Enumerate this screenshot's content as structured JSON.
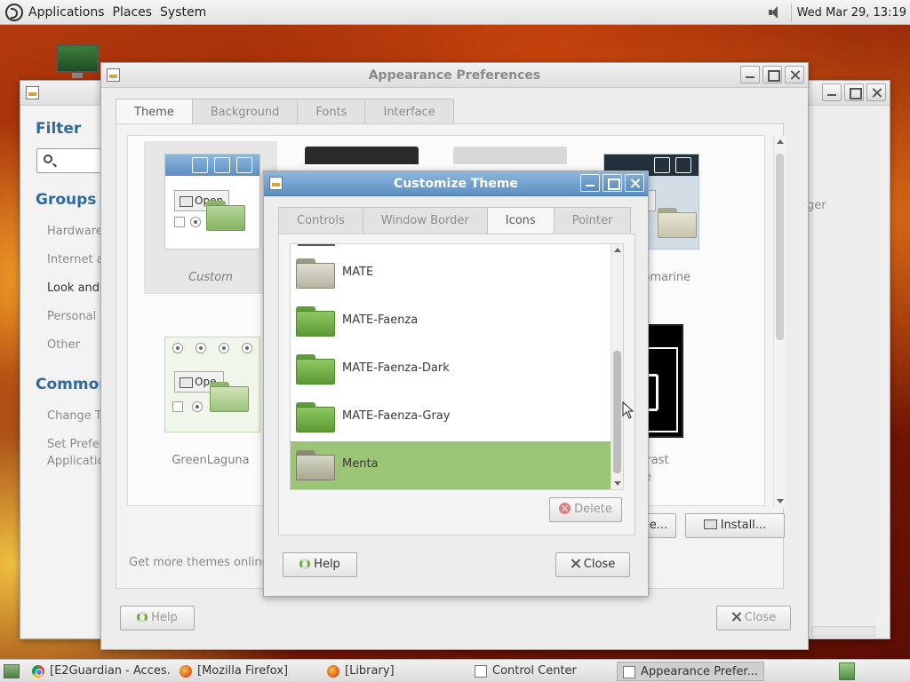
{
  "top_panel": {
    "menus": [
      "Applications",
      "Places",
      "System"
    ],
    "clock": "Wed Mar 29, 13:19"
  },
  "control_center": {
    "filter_heading": "Filter",
    "groups_heading": "Groups",
    "groups": [
      "Hardware",
      "Internet a",
      "Look and F",
      "Personal",
      "Other"
    ],
    "common_heading": "Common",
    "common": [
      "Change Th",
      "Set Prefer",
      "Applicatio"
    ],
    "right_text": "ger"
  },
  "appearance": {
    "title": "Appearance Preferences",
    "tabs": [
      "Theme",
      "Background",
      "Fonts",
      "Interface"
    ],
    "active_tab": "Theme",
    "themes": [
      {
        "label": "Custom"
      },
      {
        "label": "ubmarine"
      },
      {
        "label": "GreenLaguna"
      },
      {
        "label": "Contrast"
      },
      {
        "label": "verse"
      }
    ],
    "open_label": "Open",
    "open_label_short": "Ope",
    "get_more": "Get more themes online",
    "save_as_partial": "e...",
    "install_label": "Install...",
    "help_label": "Help",
    "close_label": "Close"
  },
  "customize_theme": {
    "title": "Customize Theme",
    "tabs": [
      "Controls",
      "Window Border",
      "Icons",
      "Pointer"
    ],
    "active_tab": "Icons",
    "icon_themes": [
      "MATE",
      "MATE-Faenza",
      "MATE-Faenza-Dark",
      "MATE-Faenza-Gray",
      "Menta"
    ],
    "selected_icon_theme": "Menta",
    "delete_label": "Delete",
    "help_label": "Help",
    "close_label": "Close"
  },
  "taskbar": {
    "tasks": [
      "[E2Guardian - Acces...",
      "[Mozilla Firefox]",
      "[Library]",
      "Control Center",
      "Appearance Prefer..."
    ]
  },
  "colors": {
    "accent_blue": "#5c8fc2",
    "selection_green": "#9bc476",
    "heading_blue": "#2d6a9e"
  }
}
